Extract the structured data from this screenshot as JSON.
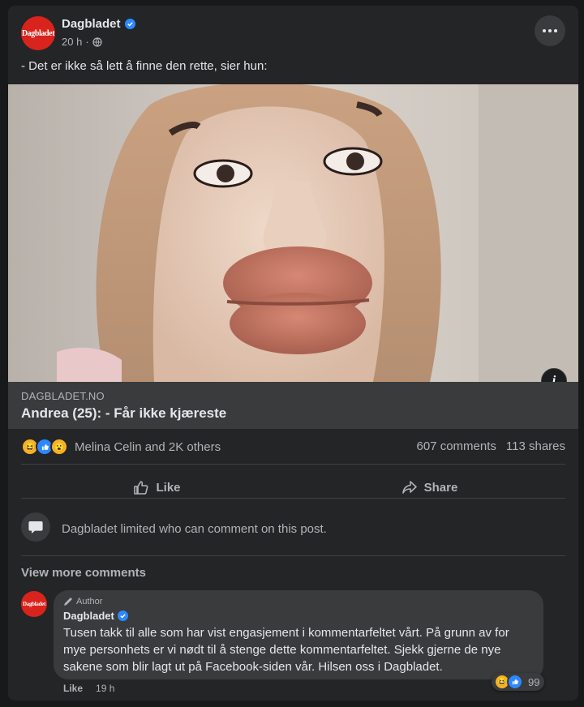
{
  "post": {
    "page_name": "Dagbladet",
    "avatar_text": "Dagbladet",
    "time": "20 h",
    "text": "- Det er ikke så lett å finne den rette, sier hun:"
  },
  "link": {
    "domain": "DAGBLADET.NO",
    "headline": "Andrea (25): - Får ikke kjæreste"
  },
  "engagement": {
    "reactors": "Melina Celin and 2K others",
    "comments": "607 comments",
    "shares": "113 shares"
  },
  "actions": {
    "like": "Like",
    "share": "Share"
  },
  "notice": "Dagbladet limited who can comment on this post.",
  "view_more": "View more comments",
  "comment": {
    "author_tag": "Author",
    "name": "Dagbladet",
    "avatar_text": "Dagbladet",
    "text": "Tusen takk til alle som har vist engasjement i kommentarfeltet vårt. På grunn av for mye personhets er vi nødt til å stenge dette kommentarfeltet. Sjekk gjerne de nye sakene som blir lagt ut på Facebook-siden vår. Hilsen oss i Dagbladet.",
    "reaction_count": "99",
    "like": "Like",
    "time": "19 h"
  },
  "colors": {
    "background": "#18191a",
    "card": "#242526",
    "surface": "#3a3b3c",
    "brand_red": "#d9231d",
    "verified_blue": "#2d88ff"
  }
}
